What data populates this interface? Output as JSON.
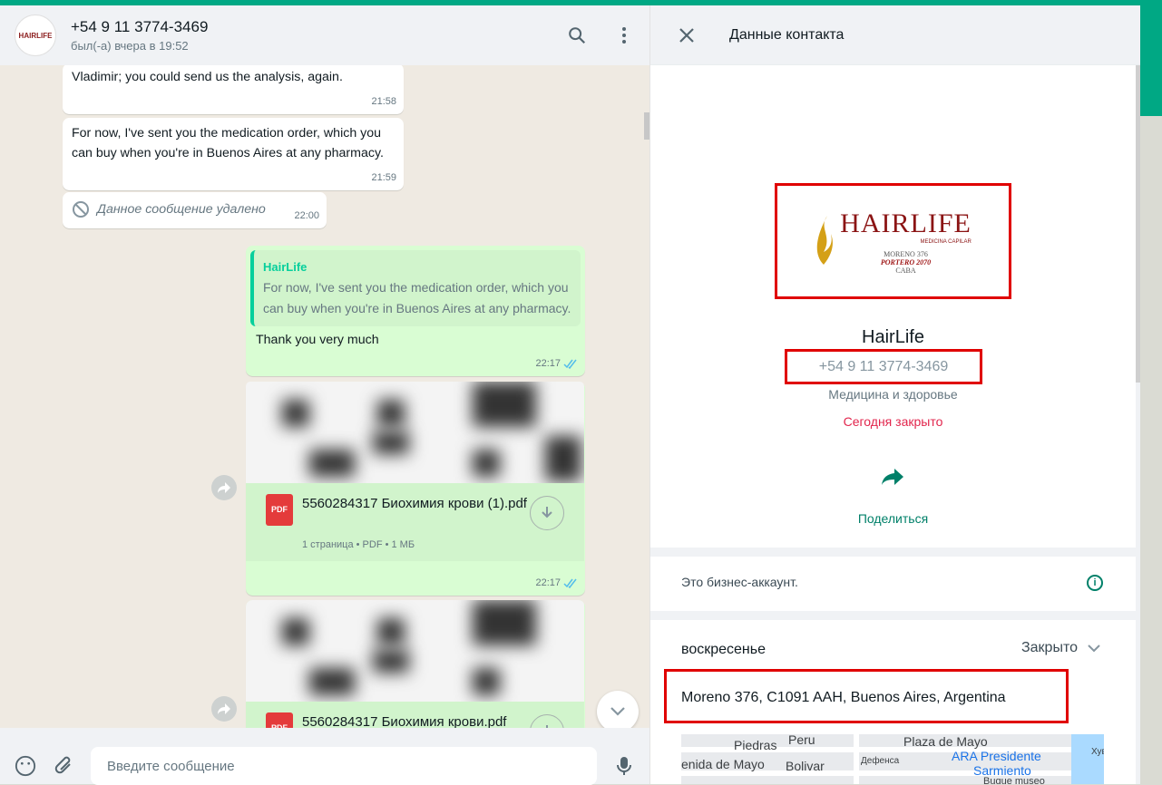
{
  "chat": {
    "header": {
      "avatar_text": "HAIRLIFE",
      "title": "+54 9 11 3774-3469",
      "subtitle": "был(-а) вчера в 19:52"
    },
    "messages": [
      {
        "text": "Vladimir; you could send us the analysis, again.",
        "time": "21:58"
      },
      {
        "text": "For now, I've sent you the medication order, which you can buy when you're in Buenos Aires at any pharmacy.",
        "time": "21:59"
      },
      {
        "text": "Данное сообщение удалено",
        "time": "22:00"
      }
    ],
    "reply": {
      "quote_author": "HairLife",
      "quote_text": "For now, I've sent you the medication order, which you can buy when you're in Buenos Aires at any pharmacy.",
      "text": "Thank you very much",
      "time": "22:17"
    },
    "documents": [
      {
        "badge": "PDF",
        "name": "5560284317 Биохимия крови (1).pdf",
        "meta": "1 страница • PDF • 1 МБ",
        "time": "22:17"
      },
      {
        "badge": "PDF",
        "name": "5560284317 Биохимия крови.pdf",
        "meta": "",
        "time": ""
      }
    ],
    "composer": {
      "placeholder": "Введите сообщение"
    }
  },
  "contact": {
    "title": "Данные контакта",
    "logo": {
      "brand": "HAIRLIFE",
      "tagline": "MEDICINA CAPILAR",
      "addr1": "MORENO 376",
      "addr2": "PORTERO 2070",
      "addr3": "CABA"
    },
    "name": "HairLife",
    "phone": "+54 9 11 3774-3469",
    "category": "Медицина и здоровье",
    "hours_status": "Сегодня закрыто",
    "share_label": "Поделиться",
    "business_note": "Это бизнес-аккаунт.",
    "day": "воскресенье",
    "day_status": "Закрыто",
    "address": "Moreno 376, C1091 AAH, Buenos Aires, Argentina",
    "map_labels": [
      "Piedras",
      "Peru",
      "Plaza de Mayo",
      "ARA Presidente",
      "Sarmiento",
      "Buque museo",
      "enida de Mayo",
      "Bolivar",
      "Дефенса",
      "Хува"
    ]
  },
  "colors": {
    "accent": "#00a884",
    "outgoing": "#d9fdd3",
    "incoming": "#ffffff",
    "highlight": "#e00000",
    "closed": "#e2264d"
  }
}
